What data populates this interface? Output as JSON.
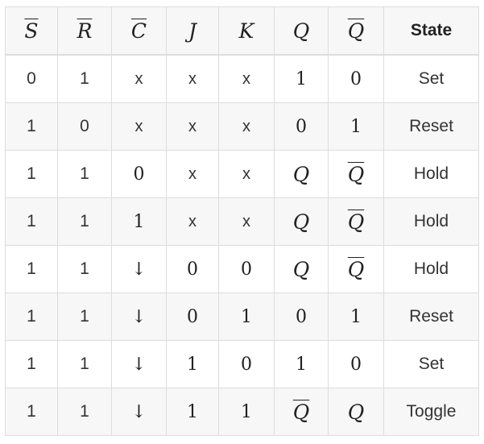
{
  "table": {
    "headers": [
      "S",
      "R",
      "C",
      "J",
      "K",
      "Q",
      "Q",
      "State"
    ],
    "header_overline": [
      true,
      true,
      true,
      false,
      false,
      false,
      true,
      false
    ],
    "rows": [
      [
        "0",
        "1",
        "x",
        "x",
        "x",
        "1",
        "0",
        "Set"
      ],
      [
        "1",
        "0",
        "x",
        "x",
        "x",
        "0",
        "1",
        "Reset"
      ],
      [
        "1",
        "1",
        "0",
        "x",
        "x",
        "Q",
        "Q",
        "Hold"
      ],
      [
        "1",
        "1",
        "1",
        "x",
        "x",
        "Q",
        "Q",
        "Hold"
      ],
      [
        "1",
        "1",
        "↓",
        "0",
        "0",
        "Q",
        "Q",
        "Hold"
      ],
      [
        "1",
        "1",
        "↓",
        "0",
        "1",
        "0",
        "1",
        "Reset"
      ],
      [
        "1",
        "1",
        "↓",
        "1",
        "0",
        "1",
        "0",
        "Set"
      ],
      [
        "1",
        "1",
        "↓",
        "1",
        "1",
        "Q",
        "Q",
        "Toggle"
      ]
    ],
    "overline_cells": [
      [
        2,
        6
      ],
      [
        3,
        6
      ],
      [
        4,
        6
      ],
      [
        7,
        5
      ]
    ]
  }
}
